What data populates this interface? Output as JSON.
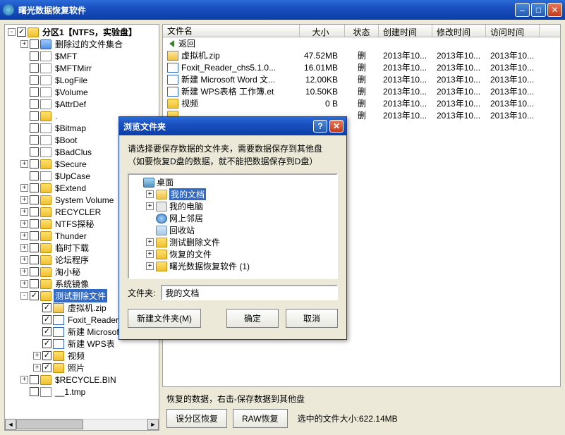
{
  "window": {
    "title": "曙光数据恢复软件"
  },
  "tree": {
    "root": "分区1【NTFS，实验盘】",
    "items": [
      {
        "depth": 0,
        "toggle": "-",
        "chk": true,
        "icon": "folder",
        "bold": true,
        "label": "分区1【NTFS，实验盘】"
      },
      {
        "depth": 1,
        "toggle": "+",
        "chk": false,
        "icon": "blue",
        "label": "删除过的文件集合"
      },
      {
        "depth": 1,
        "toggle": "",
        "chk": false,
        "icon": "file",
        "label": "$MFT"
      },
      {
        "depth": 1,
        "toggle": "",
        "chk": false,
        "icon": "file",
        "label": "$MFTMirr"
      },
      {
        "depth": 1,
        "toggle": "",
        "chk": false,
        "icon": "file",
        "label": "$LogFile"
      },
      {
        "depth": 1,
        "toggle": "",
        "chk": false,
        "icon": "file",
        "label": "$Volume"
      },
      {
        "depth": 1,
        "toggle": "",
        "chk": false,
        "icon": "file",
        "label": "$AttrDef"
      },
      {
        "depth": 1,
        "toggle": "",
        "chk": false,
        "icon": "folder",
        "label": "."
      },
      {
        "depth": 1,
        "toggle": "",
        "chk": false,
        "icon": "file",
        "label": "$Bitmap"
      },
      {
        "depth": 1,
        "toggle": "",
        "chk": false,
        "icon": "file",
        "label": "$Boot"
      },
      {
        "depth": 1,
        "toggle": "",
        "chk": false,
        "icon": "file",
        "label": "$BadClus"
      },
      {
        "depth": 1,
        "toggle": "+",
        "chk": false,
        "icon": "folder",
        "label": "$Secure"
      },
      {
        "depth": 1,
        "toggle": "",
        "chk": false,
        "icon": "file",
        "label": "$UpCase"
      },
      {
        "depth": 1,
        "toggle": "+",
        "chk": false,
        "icon": "folder",
        "label": "$Extend"
      },
      {
        "depth": 1,
        "toggle": "+",
        "chk": false,
        "icon": "folder",
        "label": "System Volume"
      },
      {
        "depth": 1,
        "toggle": "+",
        "chk": false,
        "icon": "folder",
        "label": "RECYCLER"
      },
      {
        "depth": 1,
        "toggle": "+",
        "chk": false,
        "icon": "folder",
        "label": "NTFS探秘"
      },
      {
        "depth": 1,
        "toggle": "+",
        "chk": false,
        "icon": "folder",
        "label": "Thunder"
      },
      {
        "depth": 1,
        "toggle": "+",
        "chk": false,
        "icon": "folder",
        "label": "临时下载"
      },
      {
        "depth": 1,
        "toggle": "+",
        "chk": false,
        "icon": "folder",
        "label": "论坛程序"
      },
      {
        "depth": 1,
        "toggle": "+",
        "chk": false,
        "icon": "folder",
        "label": "淘小秘"
      },
      {
        "depth": 1,
        "toggle": "+",
        "chk": false,
        "icon": "folder",
        "label": "系统镜像"
      },
      {
        "depth": 1,
        "toggle": "-",
        "chk": true,
        "icon": "folder",
        "sel": true,
        "label": "测试删除文件"
      },
      {
        "depth": 2,
        "toggle": "",
        "chk": true,
        "icon": "zip",
        "label": "虚拟机.zip"
      },
      {
        "depth": 2,
        "toggle": "",
        "chk": true,
        "icon": "doc",
        "label": "Foxit_Reader"
      },
      {
        "depth": 2,
        "toggle": "",
        "chk": true,
        "icon": "doc",
        "label": "新建 Microsof"
      },
      {
        "depth": 2,
        "toggle": "",
        "chk": true,
        "icon": "doc",
        "label": "新建 WPS表"
      },
      {
        "depth": 2,
        "toggle": "+",
        "chk": true,
        "icon": "folder",
        "label": "视频"
      },
      {
        "depth": 2,
        "toggle": "+",
        "chk": true,
        "icon": "folder",
        "label": "照片"
      },
      {
        "depth": 1,
        "toggle": "+",
        "chk": false,
        "icon": "folder",
        "label": "$RECYCLE.BIN"
      },
      {
        "depth": 1,
        "toggle": "",
        "chk": false,
        "icon": "file",
        "label": "__1.tmp"
      }
    ]
  },
  "list": {
    "headers": {
      "name": "文件名",
      "size": "大小",
      "status": "状态",
      "ctime": "创建时间",
      "mtime": "修改时间",
      "atime": "访问时间"
    },
    "return_label": "返回",
    "rows": [
      {
        "icon": "zip",
        "name": "虚拟机.zip",
        "size": "47.52MB",
        "status": "删",
        "ct": "2013年10...",
        "mt": "2013年10...",
        "at": "2013年10..."
      },
      {
        "icon": "doc",
        "name": "Foxit_Reader_chs5.1.0...",
        "size": "16.01MB",
        "status": "删",
        "ct": "2013年10...",
        "mt": "2013年10...",
        "at": "2013年10..."
      },
      {
        "icon": "doc",
        "name": "新建 Microsoft Word 文...",
        "size": "12.00KB",
        "status": "删",
        "ct": "2013年10...",
        "mt": "2013年10...",
        "at": "2013年10..."
      },
      {
        "icon": "doc",
        "name": "新建 WPS表格 工作簿.et",
        "size": "10.50KB",
        "status": "删",
        "ct": "2013年10...",
        "mt": "2013年10...",
        "at": "2013年10..."
      },
      {
        "icon": "folder",
        "name": "视频",
        "size": "0 B",
        "status": "删",
        "ct": "2013年10...",
        "mt": "2013年10...",
        "at": "2013年10..."
      },
      {
        "icon": "folder",
        "name": "",
        "size": "",
        "status": "删",
        "ct": "2013年10...",
        "mt": "2013年10...",
        "at": "2013年10..."
      }
    ]
  },
  "bottom": {
    "hint": "恢复的数据，右击-保存数据到其他盘",
    "btn_mispart": "误分区恢复",
    "btn_raw": "RAW恢复",
    "sel_label": "选中的文件大小:",
    "sel_value": "622.14MB"
  },
  "dialog": {
    "title": "浏览文件夹",
    "msg1": "请选择要保存数据的文件夹，需要数据保存到其他盘",
    "msg2": "（如要恢复D盘的数据，就不能把数据保存到D盘）",
    "tree": [
      {
        "depth": 0,
        "toggle": "",
        "icon": "desktop",
        "label": "桌面"
      },
      {
        "depth": 1,
        "toggle": "+",
        "icon": "docs",
        "label": "我的文档",
        "sel": true
      },
      {
        "depth": 1,
        "toggle": "+",
        "icon": "mycomp",
        "label": "我的电脑"
      },
      {
        "depth": 1,
        "toggle": "",
        "icon": "net",
        "label": "网上邻居"
      },
      {
        "depth": 1,
        "toggle": "",
        "icon": "recycle",
        "label": "回收站"
      },
      {
        "depth": 1,
        "toggle": "+",
        "icon": "folder",
        "label": "测试删除文件"
      },
      {
        "depth": 1,
        "toggle": "+",
        "icon": "folder",
        "label": "恢复的文件"
      },
      {
        "depth": 1,
        "toggle": "+",
        "icon": "folder",
        "label": "曙光数据恢复软件 (1)"
      }
    ],
    "folder_label": "文件夹:",
    "folder_value": "我的文档",
    "btn_new": "新建文件夹(M)",
    "btn_ok": "确定",
    "btn_cancel": "取消"
  }
}
